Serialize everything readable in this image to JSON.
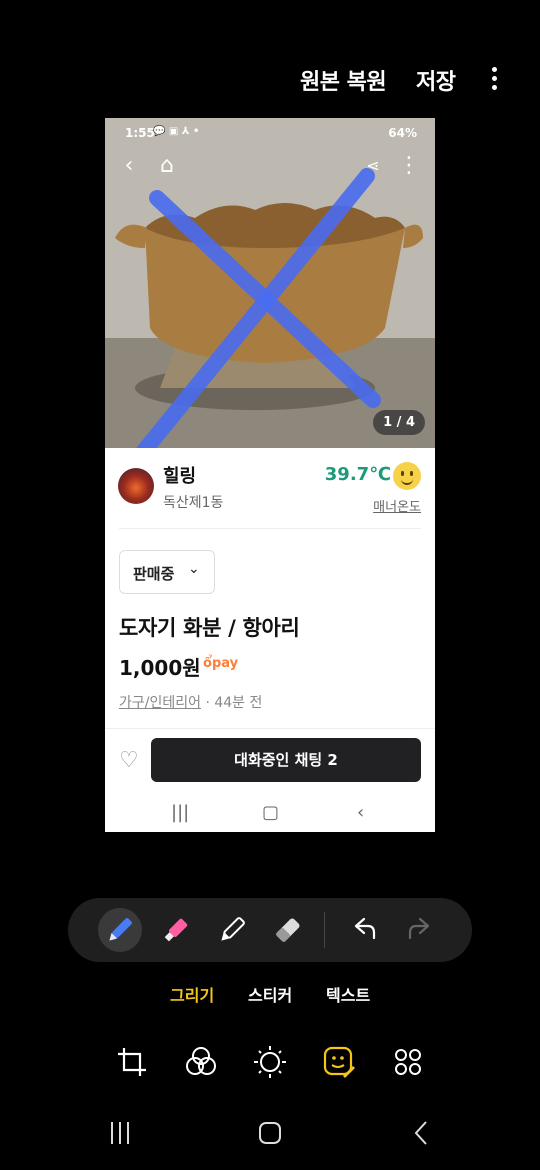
{
  "editor": {
    "restore_label": "원본 복원",
    "save_label": "저장",
    "more_icon": "more-vertical-icon"
  },
  "screenshot": {
    "status": {
      "time": "1:55",
      "icons": "💬 ▣ ⅄ •",
      "battery": "64%"
    },
    "photo_counter": "1 / 4",
    "seller": {
      "name": "힐링",
      "location": "독산제1동",
      "temperature": "39.7℃",
      "manner_label": "매너온도"
    },
    "sale_status": "판매중",
    "item_title": "도자기 화분  / 항아리",
    "price": "1,000원",
    "pay_label": "pay",
    "category": "가구/인테리어",
    "time_ago": "· 44분 전",
    "chat_button": "대화중인 채팅 2"
  },
  "tabs": [
    {
      "label": "그리기",
      "active": true
    },
    {
      "label": "스티커",
      "active": false
    },
    {
      "label": "텍스트",
      "active": false
    }
  ],
  "colors": {
    "accent": "#f5c518",
    "markup": "#4a6cf0",
    "temperature": "#1c9a7a",
    "pay": "#ff7e36"
  }
}
